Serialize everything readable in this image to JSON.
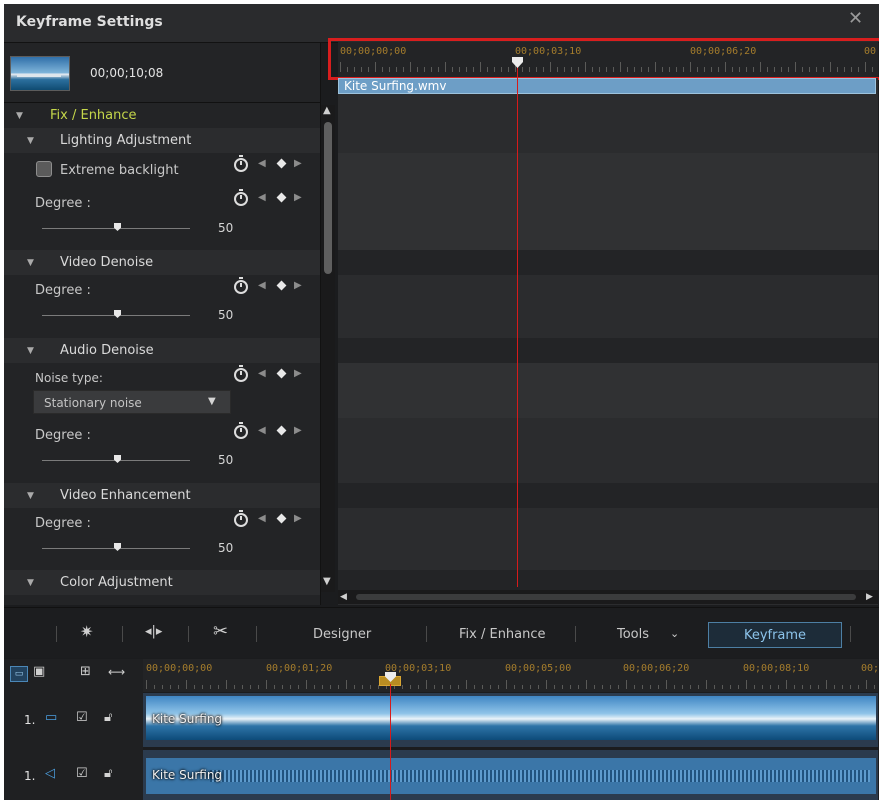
{
  "window": {
    "title": "Keyframe Settings",
    "close_glyph": "✕"
  },
  "clip": {
    "current_time": "00;00;10;08",
    "name": "Kite Surfing.wmv"
  },
  "panel": {
    "section": "Fix / Enhance",
    "groups": [
      {
        "title": "Lighting Adjustment",
        "checkbox_label": "Extreme backlight",
        "degree_label": "Degree :",
        "value": "50"
      },
      {
        "title": "Video Denoise",
        "degree_label": "Degree :",
        "value": "50"
      },
      {
        "title": "Audio Denoise",
        "noise_type_label": "Noise type:",
        "noise_type_value": "Stationary noise",
        "degree_label": "Degree :",
        "value": "50"
      },
      {
        "title": "Video Enhancement",
        "degree_label": "Degree :",
        "value": "50"
      },
      {
        "title": "Color Adjustment"
      }
    ]
  },
  "timeline": {
    "ruler_labels": [
      "00;00;00;00",
      "00;00;03;10",
      "00;00;06;20",
      "00"
    ],
    "accent_color": "#d81e1e"
  },
  "toolbar": {
    "designer": "Designer",
    "fix_enhance": "Fix / Enhance",
    "tools": "Tools",
    "keyframe": "Keyframe"
  },
  "bottom_timeline": {
    "ruler_labels": [
      "00;00;00;00",
      "00;00;01;20",
      "00;00;03;10",
      "00;00;05;00",
      "00;00;06;20",
      "00;00;08;10",
      "00;"
    ],
    "tracks": [
      {
        "index": "1.",
        "clip_label": "Kite Surfing",
        "type": "video"
      },
      {
        "index": "1.",
        "clip_label": "Kite Surfing",
        "type": "audio"
      }
    ]
  }
}
